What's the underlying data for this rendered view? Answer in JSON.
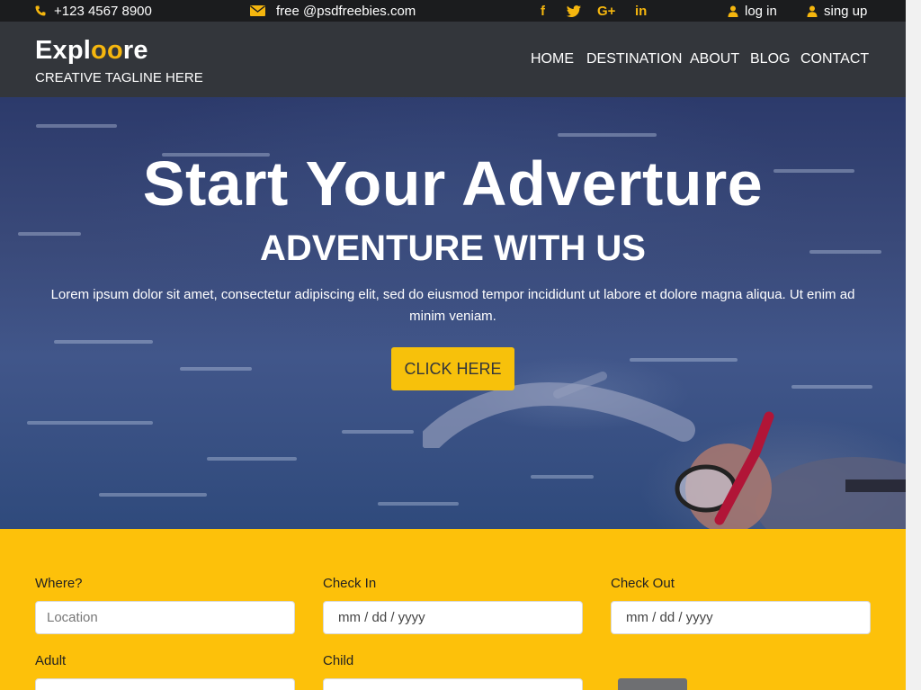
{
  "topbar": {
    "phone": "+123 4567 8900",
    "email": "free @psdfreebies.com",
    "social": [
      "f",
      "t",
      "G+",
      "in"
    ],
    "login": "log in",
    "signup": "sing up"
  },
  "header": {
    "brand_prefix": "Expl",
    "brand_highlight": "oo",
    "brand_suffix": "re",
    "tagline": "CREATIVE TAGLINE HERE",
    "nav": [
      "HOME",
      "DESTINATION",
      "ABOUT",
      "BLOG",
      "CONTACT"
    ]
  },
  "hero": {
    "title": "Start Your Adverture",
    "subtitle": "ADVENTURE WITH US",
    "text": "Lorem ipsum dolor sit amet, consectetur adipiscing elit, sed do eiusmod tempor incididunt ut labore et dolore magna aliqua. Ut enim ad minim veniam.",
    "cta": "CLICK HERE"
  },
  "booking": {
    "where_label": "Where?",
    "where_placeholder": "Location",
    "checkin_label": "Check In",
    "checkin_placeholder": "mm / dd / yyyy",
    "checkout_label": "Check Out",
    "checkout_placeholder": "mm / dd / yyyy",
    "adult_label": "Adult",
    "child_label": "Child"
  },
  "colors": {
    "accent": "#f5b60e",
    "header_bg": "#33363b",
    "topbar_bg": "#1b1c1e",
    "booking_bg": "#fdc10a"
  }
}
